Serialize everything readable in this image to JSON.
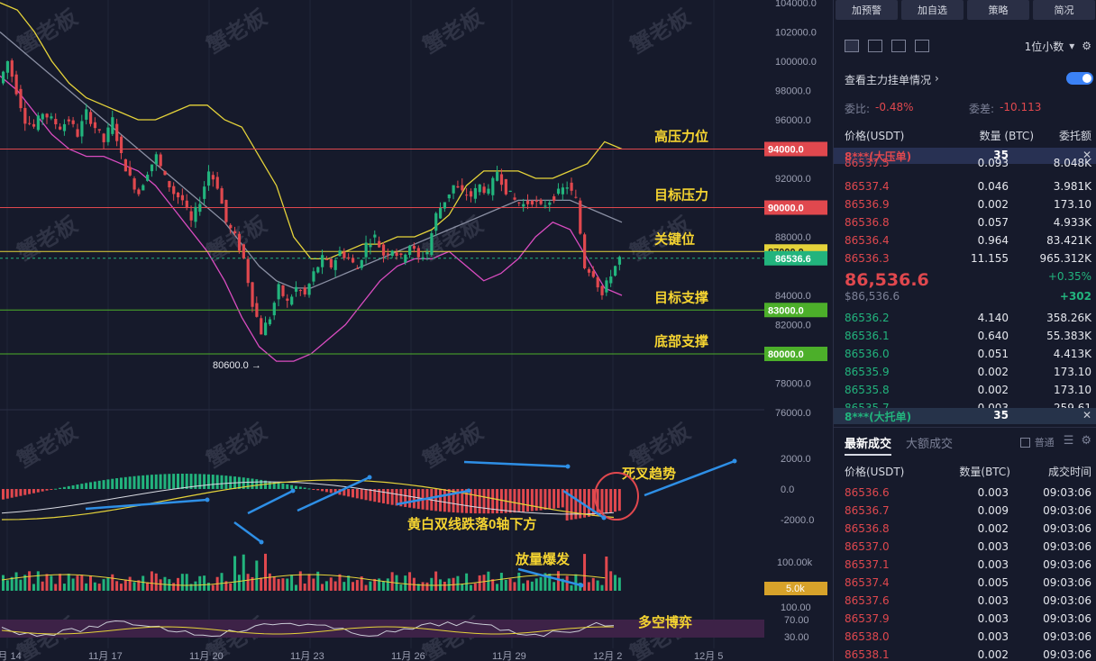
{
  "colors": {
    "up": "#22b47d",
    "down": "#e0484e",
    "bg": "#161a2b",
    "yellow": "#e5d33a",
    "pink": "#d94cc0",
    "gray": "#8a8fa3"
  },
  "watermark": "蟹老板",
  "chart_data": {
    "type": "candlestick",
    "price_axis": {
      "min": 76000,
      "max": 104000,
      "ticks": [
        104000,
        102000,
        100000,
        98000,
        96000,
        94000,
        92000,
        90000,
        88000,
        87000,
        86000,
        84000,
        82000,
        80000,
        78000,
        76000
      ],
      "tick_labels": [
        "104000.0",
        "102000.0",
        "100000.0",
        "98000.0",
        "96000.0",
        "94000.0",
        "92000.0",
        "90000.0",
        "88000.0",
        "87000.0",
        "86000.0",
        "84000.0",
        "82000.0",
        "80000.0",
        "78000.0",
        "76000.0"
      ]
    },
    "date_labels": [
      "11月 14",
      "11月 17",
      "11月 20",
      "11月 23",
      "11月 26",
      "11月 29",
      "12月 2",
      "12月 5"
    ],
    "last_price": 86536.6,
    "last_price_label": "86536.6",
    "low_marker": {
      "value": 80600.0,
      "label": "80600.0 →"
    },
    "levels": [
      {
        "value": 94000,
        "label": "94000.0",
        "name": "高压力位",
        "color": "#e0484e"
      },
      {
        "value": 90000,
        "label": "90000.0",
        "name": "目标压力",
        "color": "#e0484e"
      },
      {
        "value": 87000,
        "label": "87000.0",
        "name": "关键位",
        "color": "#e5d33a"
      },
      {
        "value": 83000,
        "label": "83000.0",
        "name": "目标支撑",
        "color": "#4caf2a"
      },
      {
        "value": 80000,
        "label": "80000.0",
        "name": "底部支撑",
        "color": "#4caf2a"
      }
    ],
    "price_path": [
      {
        "t": 0,
        "p": 98500
      },
      {
        "t": 2,
        "p": 100000
      },
      {
        "t": 4,
        "p": 98000
      },
      {
        "t": 6,
        "p": 96000
      },
      {
        "t": 8,
        "p": 95500
      },
      {
        "t": 10,
        "p": 96500
      },
      {
        "t": 12,
        "p": 96000
      },
      {
        "t": 14,
        "p": 95500
      },
      {
        "t": 16,
        "p": 96000
      },
      {
        "t": 18,
        "p": 95000
      },
      {
        "t": 20,
        "p": 96500
      },
      {
        "t": 22,
        "p": 95500
      },
      {
        "t": 24,
        "p": 94500
      },
      {
        "t": 26,
        "p": 96000
      },
      {
        "t": 28,
        "p": 93500
      },
      {
        "t": 30,
        "p": 92000
      },
      {
        "t": 32,
        "p": 91000
      },
      {
        "t": 34,
        "p": 92500
      },
      {
        "t": 36,
        "p": 93500
      },
      {
        "t": 38,
        "p": 92000
      },
      {
        "t": 40,
        "p": 91000
      },
      {
        "t": 42,
        "p": 90500
      },
      {
        "t": 44,
        "p": 89000
      },
      {
        "t": 46,
        "p": 90500
      },
      {
        "t": 48,
        "p": 92500
      },
      {
        "t": 50,
        "p": 91500
      },
      {
        "t": 52,
        "p": 89000
      },
      {
        "t": 54,
        "p": 88000
      },
      {
        "t": 56,
        "p": 86500
      },
      {
        "t": 58,
        "p": 83500
      },
      {
        "t": 60,
        "p": 81500
      },
      {
        "t": 62,
        "p": 82500
      },
      {
        "t": 64,
        "p": 84500
      },
      {
        "t": 66,
        "p": 83500
      },
      {
        "t": 68,
        "p": 84500
      },
      {
        "t": 70,
        "p": 84000
      },
      {
        "t": 72,
        "p": 85500
      },
      {
        "t": 74,
        "p": 86500
      },
      {
        "t": 76,
        "p": 86000
      },
      {
        "t": 78,
        "p": 87000
      },
      {
        "t": 80,
        "p": 86500
      },
      {
        "t": 82,
        "p": 85800
      },
      {
        "t": 84,
        "p": 87500
      },
      {
        "t": 86,
        "p": 88000
      },
      {
        "t": 88,
        "p": 86800
      },
      {
        "t": 90,
        "p": 87200
      },
      {
        "t": 92,
        "p": 86500
      },
      {
        "t": 94,
        "p": 87500
      },
      {
        "t": 96,
        "p": 86500
      },
      {
        "t": 98,
        "p": 87000
      },
      {
        "t": 100,
        "p": 89500
      },
      {
        "t": 102,
        "p": 90500
      },
      {
        "t": 104,
        "p": 91500
      },
      {
        "t": 106,
        "p": 91000
      },
      {
        "t": 108,
        "p": 90800
      },
      {
        "t": 110,
        "p": 91500
      },
      {
        "t": 112,
        "p": 91000
      },
      {
        "t": 114,
        "p": 92500
      },
      {
        "t": 116,
        "p": 91200
      },
      {
        "t": 118,
        "p": 90500
      },
      {
        "t": 120,
        "p": 90200
      },
      {
        "t": 122,
        "p": 90500
      },
      {
        "t": 124,
        "p": 90000
      },
      {
        "t": 126,
        "p": 90500
      },
      {
        "t": 128,
        "p": 91000
      },
      {
        "t": 130,
        "p": 91500
      },
      {
        "t": 132,
        "p": 90500
      },
      {
        "t": 134,
        "p": 86000
      },
      {
        "t": 136,
        "p": 85500
      },
      {
        "t": 138,
        "p": 84000
      },
      {
        "t": 140,
        "p": 85500
      },
      {
        "t": 142,
        "p": 86536
      }
    ],
    "bollinger": {
      "upper": [
        104000,
        103500,
        102000,
        100000,
        98500,
        97500,
        97000,
        96500,
        96000,
        96000,
        96500,
        97000,
        97000,
        96000,
        95500,
        93500,
        91500,
        88000,
        86500,
        86500,
        87000,
        87500,
        87500,
        88000,
        88000,
        88500,
        89500,
        91500,
        92500,
        92500,
        92500,
        92000,
        92000,
        92500,
        93000,
        94500,
        94000
      ],
      "middle": [
        102000,
        101000,
        100000,
        99000,
        98000,
        97000,
        96000,
        95000,
        94000,
        93000,
        92000,
        91000,
        90000,
        89000,
        87500,
        86000,
        85000,
        84500,
        84500,
        85000,
        85500,
        86000,
        86500,
        87000,
        87500,
        88000,
        88500,
        89000,
        89500,
        90000,
        90500,
        90500,
        90500,
        90500,
        90000,
        89500,
        89000
      ],
      "lower": [
        99000,
        98000,
        96500,
        95000,
        94000,
        93500,
        93500,
        93000,
        92500,
        91500,
        90000,
        88500,
        87000,
        85000,
        82500,
        80500,
        79500,
        79500,
        80000,
        81000,
        82000,
        83500,
        85000,
        86000,
        86500,
        86500,
        87000,
        86000,
        85000,
        85500,
        86500,
        88000,
        89000,
        88500,
        86500,
        84500,
        84000
      ]
    },
    "macd": {
      "axis_ticks": [
        "2000.0",
        "0.0",
        "-2000.0"
      ],
      "axis_values": [
        2000,
        0,
        -2000
      ],
      "annotation1": "死叉趋势",
      "annotation2": "黄白双线跌落0轴下方"
    },
    "volume": {
      "axis_ticks": [
        "100.00k",
        "5.0k"
      ],
      "current_label": "5.0k",
      "annotation": "放量爆发"
    },
    "rsi": {
      "axis_ticks": [
        "100.00",
        "70.00",
        "30.00"
      ],
      "annotation": "多空博弈"
    }
  },
  "panel": {
    "buttons": [
      "加预警",
      "加自选",
      "策略",
      "简况"
    ],
    "decimal_select": "1位小数",
    "view_main": "查看主力挂单情况",
    "ratio_label": "委比:",
    "ratio_value": "-0.48%",
    "diff_label": "委差:",
    "diff_value": "-10.113",
    "col_price": "价格(USDT)",
    "col_qty": "数量 (BTC)",
    "col_total": "委托额",
    "big_ask_label": "8***(大压单)",
    "big_ask_qty": "35",
    "asks": [
      {
        "p": "86537.5",
        "q": "0.093",
        "t": "8.048K"
      },
      {
        "p": "86537.4",
        "q": "0.046",
        "t": "3.981K"
      },
      {
        "p": "86536.9",
        "q": "0.002",
        "t": "173.10"
      },
      {
        "p": "86536.8",
        "q": "0.057",
        "t": "4.933K"
      },
      {
        "p": "86536.4",
        "q": "0.964",
        "t": "83.421K"
      },
      {
        "p": "86536.3",
        "q": "11.155",
        "t": "965.312K"
      }
    ],
    "mid_price": "86,536.6",
    "mid_change_pct": "+0.35%",
    "mid_sub": "$86,536.6",
    "mid_change": "+302",
    "bids": [
      {
        "p": "86536.2",
        "q": "4.140",
        "t": "358.26K"
      },
      {
        "p": "86536.1",
        "q": "0.640",
        "t": "55.383K"
      },
      {
        "p": "86536.0",
        "q": "0.051",
        "t": "4.413K"
      },
      {
        "p": "86535.9",
        "q": "0.002",
        "t": "173.10"
      },
      {
        "p": "86535.8",
        "q": "0.002",
        "t": "173.10"
      },
      {
        "p": "86535.7",
        "q": "0.003",
        "t": "259.61"
      }
    ],
    "big_bid_label": "8***(大托单)",
    "big_bid_qty": "35",
    "tab_trades": "最新成交",
    "tab_big": "大额成交",
    "normal_label": "普通",
    "trade_col_price": "价格(USDT)",
    "trade_col_qty": "数量(BTC)",
    "trade_col_time": "成交时间",
    "trades": [
      {
        "p": "86536.6",
        "q": "0.003",
        "t": "09:03:06"
      },
      {
        "p": "86536.7",
        "q": "0.009",
        "t": "09:03:06"
      },
      {
        "p": "86536.8",
        "q": "0.002",
        "t": "09:03:06"
      },
      {
        "p": "86537.0",
        "q": "0.003",
        "t": "09:03:06"
      },
      {
        "p": "86537.1",
        "q": "0.003",
        "t": "09:03:06"
      },
      {
        "p": "86537.4",
        "q": "0.005",
        "t": "09:03:06"
      },
      {
        "p": "86537.6",
        "q": "0.003",
        "t": "09:03:06"
      },
      {
        "p": "86537.9",
        "q": "0.003",
        "t": "09:03:06"
      },
      {
        "p": "86538.0",
        "q": "0.003",
        "t": "09:03:06"
      },
      {
        "p": "86538.1",
        "q": "0.002",
        "t": "09:03:06"
      }
    ]
  }
}
